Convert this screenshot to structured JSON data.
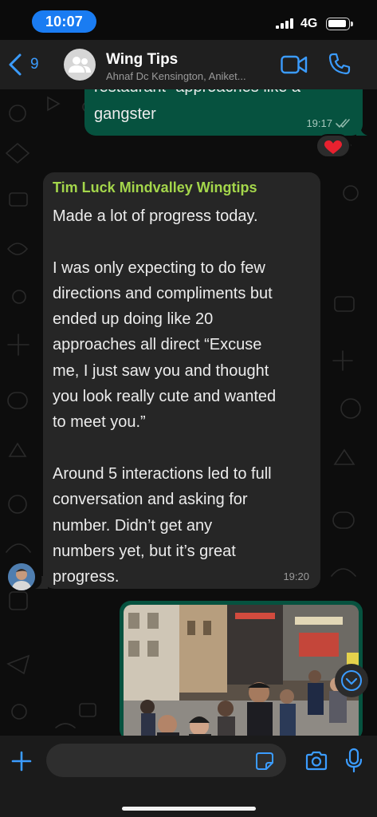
{
  "status_bar": {
    "time": "10:07",
    "network": "4G",
    "battery_level": 0.8
  },
  "header": {
    "back_count": "9",
    "title": "Wing Tips",
    "subtitle": "Ahnaf Dc Kensington, Aniket...",
    "icons": [
      "chevron-left-icon",
      "group-avatar-icon",
      "video-call-icon",
      "phone-icon"
    ]
  },
  "outgoing_message": {
    "line_partial": "restaurant” approaches like a",
    "line_last": "gangster",
    "time": "19:17",
    "status": "read",
    "reaction": "heart"
  },
  "incoming_message": {
    "sender": "Tim Luck Mindvalley Wingtips",
    "paragraphs": [
      [
        "Made a lot of progress today."
      ],
      [
        "I was only expecting to do few",
        "directions and compliments but",
        "ended up doing like 20",
        "approaches all direct “Excuse",
        "me, I just saw you and thought",
        "you look really cute and wanted",
        "to meet you.”"
      ],
      [
        "Around 5 interactions led to full",
        "conversation and asking for",
        "number. Didn’t get any",
        "numbers yet, but it’s great",
        "progress."
      ]
    ],
    "time": "19:20"
  },
  "image_message": {
    "content": "photo-street-crowd"
  },
  "composer": {
    "input_value": "",
    "input_placeholder": "",
    "icons": [
      "plus-icon",
      "sticker-icon",
      "camera-icon",
      "microphone-icon"
    ]
  },
  "colors": {
    "accent_blue": "#3b9cff",
    "time_pill": "#1a7cf2",
    "outgoing_bubble": "#06523f",
    "incoming_bubble": "#262626",
    "sender_name": "#a4d64b",
    "read_ticks": "#8fb7aa",
    "heart": "#e8212f"
  }
}
